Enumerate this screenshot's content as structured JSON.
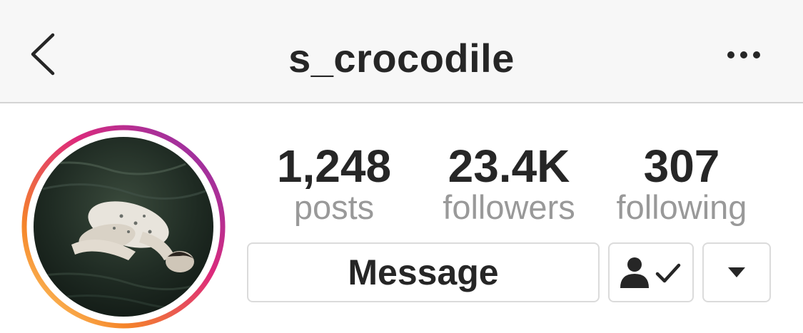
{
  "header": {
    "username": "s_crocodile",
    "back_icon": "chevron-left-icon",
    "more_icon": "more-horizontal-icon"
  },
  "profile": {
    "avatar_ring_colors": [
      "#f58529",
      "#dd2a7b",
      "#8134af"
    ],
    "stats": [
      {
        "value": "1,248",
        "label": "posts"
      },
      {
        "value": "23.4K",
        "label": "followers"
      },
      {
        "value": "307",
        "label": "following"
      }
    ]
  },
  "actions": {
    "message_label": "Message",
    "following_icon": "person-check-icon",
    "dropdown_icon": "triangle-down-icon"
  },
  "colors": {
    "text_primary": "#262626",
    "text_secondary": "#999999",
    "border": "#dbdbdb",
    "header_bg": "#f7f7f7"
  }
}
